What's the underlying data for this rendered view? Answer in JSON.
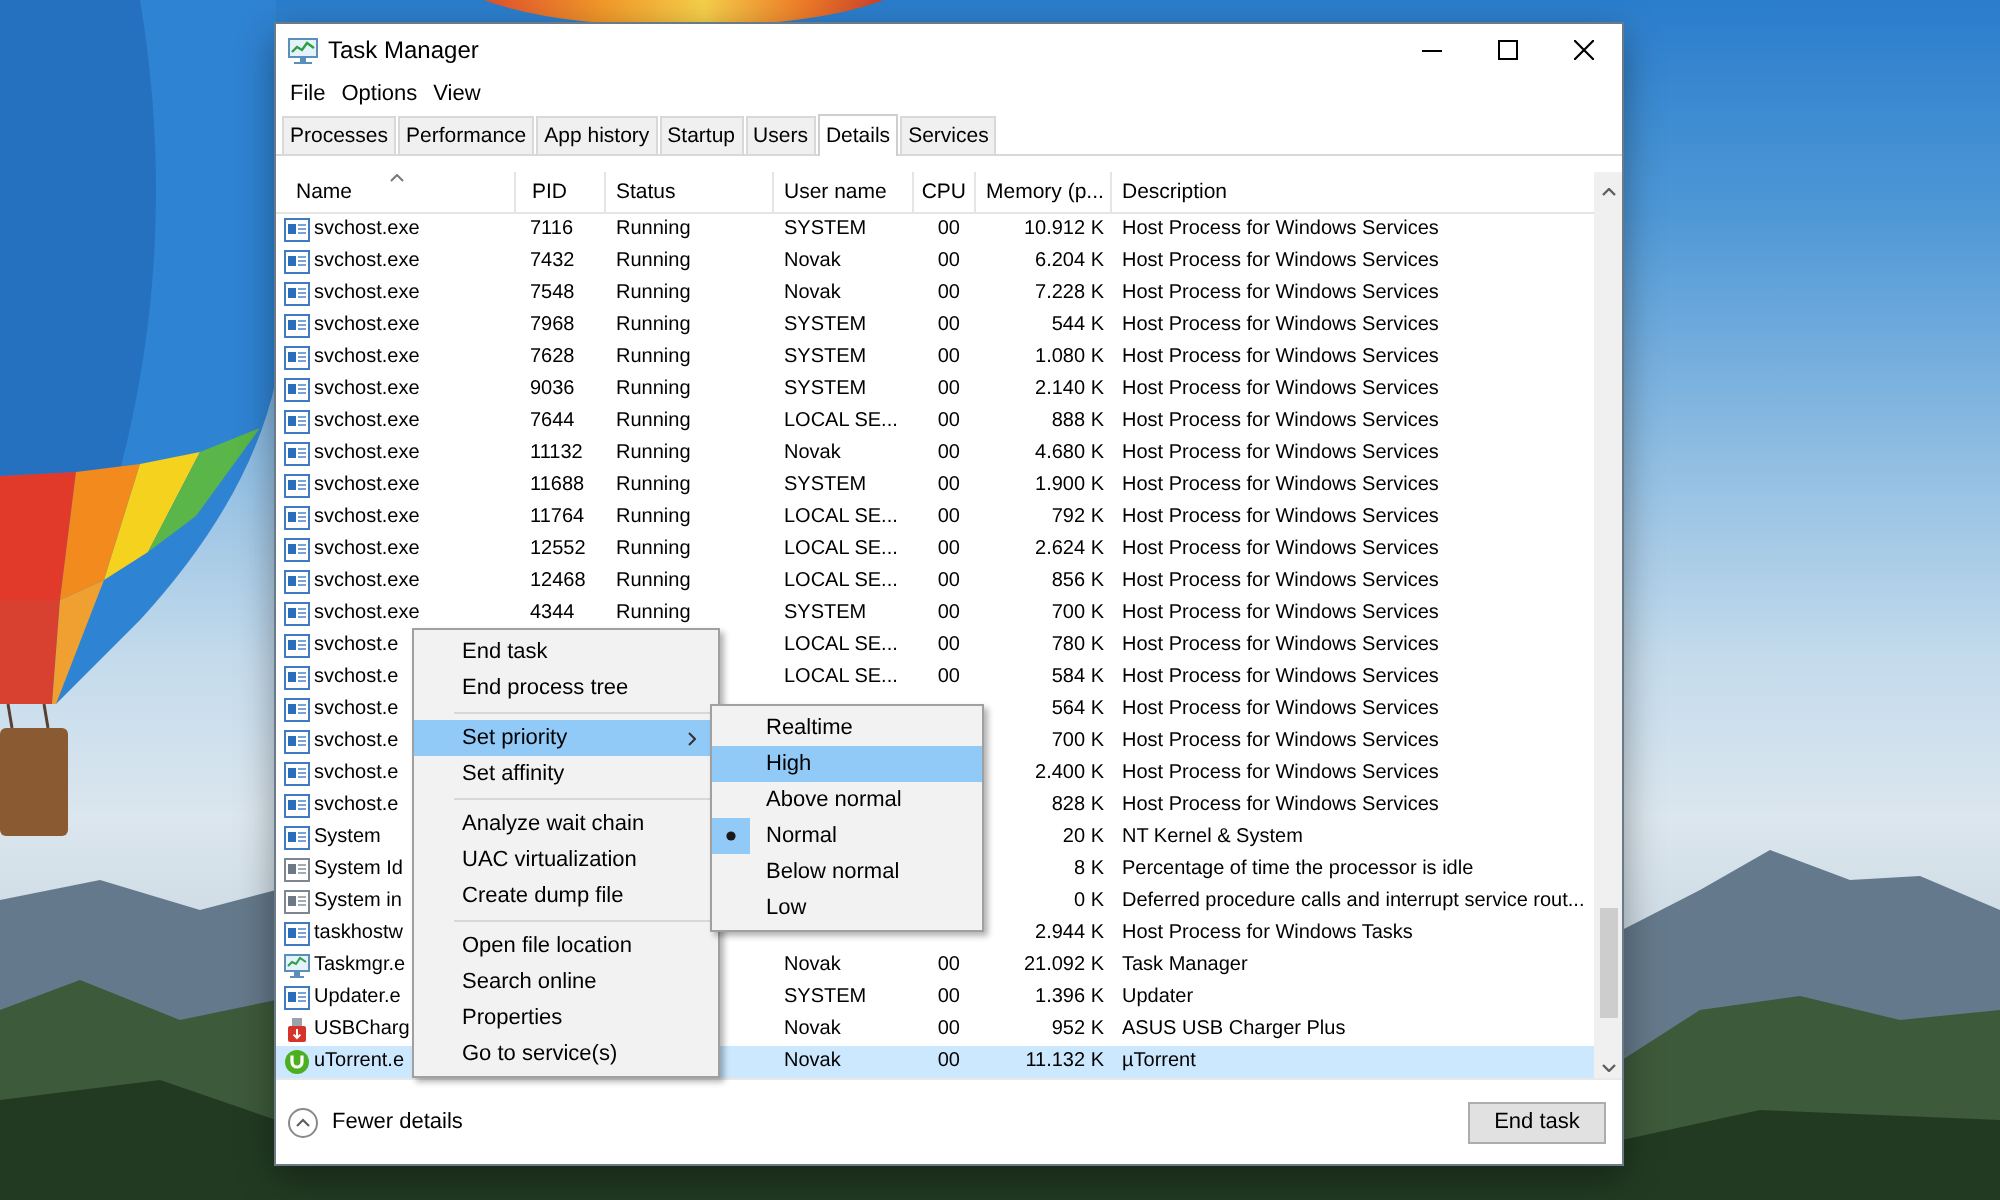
{
  "window": {
    "title": "Task Manager"
  },
  "menu_bar": [
    "File",
    "Options",
    "View"
  ],
  "tabs": [
    {
      "label": "Processes",
      "selected": false
    },
    {
      "label": "Performance",
      "selected": false
    },
    {
      "label": "App history",
      "selected": false
    },
    {
      "label": "Startup",
      "selected": false
    },
    {
      "label": "Users",
      "selected": false
    },
    {
      "label": "Details",
      "selected": true
    },
    {
      "label": "Services",
      "selected": false
    }
  ],
  "table": {
    "columns": [
      {
        "label": "Name",
        "sorted": true
      },
      {
        "label": "PID",
        "sorted": false
      },
      {
        "label": "Status",
        "sorted": false
      },
      {
        "label": "User name",
        "sorted": false
      },
      {
        "label": "CPU",
        "sorted": false
      },
      {
        "label": "Memory (p...",
        "sorted": false
      },
      {
        "label": "Description",
        "sorted": false
      }
    ],
    "rows": [
      {
        "kind": "exe",
        "selected": false,
        "name": "svchost.exe",
        "pid": "7116",
        "status": "Running",
        "user": "SYSTEM",
        "cpu": "00",
        "memory": "10.912 K",
        "description": "Host Process for Windows Services"
      },
      {
        "kind": "exe",
        "selected": false,
        "name": "svchost.exe",
        "pid": "7432",
        "status": "Running",
        "user": "Novak",
        "cpu": "00",
        "memory": "6.204 K",
        "description": "Host Process for Windows Services"
      },
      {
        "kind": "exe",
        "selected": false,
        "name": "svchost.exe",
        "pid": "7548",
        "status": "Running",
        "user": "Novak",
        "cpu": "00",
        "memory": "7.228 K",
        "description": "Host Process for Windows Services"
      },
      {
        "kind": "exe",
        "selected": false,
        "name": "svchost.exe",
        "pid": "7968",
        "status": "Running",
        "user": "SYSTEM",
        "cpu": "00",
        "memory": "544 K",
        "description": "Host Process for Windows Services"
      },
      {
        "kind": "exe",
        "selected": false,
        "name": "svchost.exe",
        "pid": "7628",
        "status": "Running",
        "user": "SYSTEM",
        "cpu": "00",
        "memory": "1.080 K",
        "description": "Host Process for Windows Services"
      },
      {
        "kind": "exe",
        "selected": false,
        "name": "svchost.exe",
        "pid": "9036",
        "status": "Running",
        "user": "SYSTEM",
        "cpu": "00",
        "memory": "2.140 K",
        "description": "Host Process for Windows Services"
      },
      {
        "kind": "exe",
        "selected": false,
        "name": "svchost.exe",
        "pid": "7644",
        "status": "Running",
        "user": "LOCAL SE...",
        "cpu": "00",
        "memory": "888 K",
        "description": "Host Process for Windows Services"
      },
      {
        "kind": "exe",
        "selected": false,
        "name": "svchost.exe",
        "pid": "11132",
        "status": "Running",
        "user": "Novak",
        "cpu": "00",
        "memory": "4.680 K",
        "description": "Host Process for Windows Services"
      },
      {
        "kind": "exe",
        "selected": false,
        "name": "svchost.exe",
        "pid": "11688",
        "status": "Running",
        "user": "SYSTEM",
        "cpu": "00",
        "memory": "1.900 K",
        "description": "Host Process for Windows Services"
      },
      {
        "kind": "exe",
        "selected": false,
        "name": "svchost.exe",
        "pid": "11764",
        "status": "Running",
        "user": "LOCAL SE...",
        "cpu": "00",
        "memory": "792 K",
        "description": "Host Process for Windows Services"
      },
      {
        "kind": "exe",
        "selected": false,
        "name": "svchost.exe",
        "pid": "12552",
        "status": "Running",
        "user": "LOCAL SE...",
        "cpu": "00",
        "memory": "2.624 K",
        "description": "Host Process for Windows Services"
      },
      {
        "kind": "exe",
        "selected": false,
        "name": "svchost.exe",
        "pid": "12468",
        "status": "Running",
        "user": "LOCAL SE...",
        "cpu": "00",
        "memory": "856 K",
        "description": "Host Process for Windows Services"
      },
      {
        "kind": "exe",
        "selected": false,
        "name": "svchost.exe",
        "pid": "4344",
        "status": "Running",
        "user": "SYSTEM",
        "cpu": "00",
        "memory": "700 K",
        "description": "Host Process for Windows Services"
      },
      {
        "kind": "exe",
        "selected": false,
        "name": "svchost.e",
        "user": "LOCAL SE...",
        "cpu": "00",
        "memory": "780 K",
        "description": "Host Process for Windows Services"
      },
      {
        "kind": "exe",
        "selected": false,
        "name": "svchost.e",
        "user": "LOCAL SE...",
        "cpu": "00",
        "memory": "584 K",
        "description": "Host Process for Windows Services"
      },
      {
        "kind": "exe",
        "selected": false,
        "name": "svchost.e",
        "memory": "564 K",
        "description": "Host Process for Windows Services"
      },
      {
        "kind": "exe",
        "selected": false,
        "name": "svchost.e",
        "memory": "700 K",
        "description": "Host Process for Windows Services"
      },
      {
        "kind": "exe",
        "selected": false,
        "name": "svchost.e",
        "memory": "2.400 K",
        "description": "Host Process for Windows Services"
      },
      {
        "kind": "exe",
        "selected": false,
        "name": "svchost.e",
        "memory": "828 K",
        "description": "Host Process for Windows Services"
      },
      {
        "kind": "exe",
        "selected": false,
        "name": "System",
        "memory": "20 K",
        "description": "NT Kernel & System"
      },
      {
        "kind": "virtual",
        "selected": false,
        "name": "System Id",
        "memory": "8 K",
        "description": "Percentage of time the processor is idle"
      },
      {
        "kind": "virtual",
        "selected": false,
        "name": "System in",
        "memory": "0 K",
        "description": "Deferred procedure calls and interrupt service rout..."
      },
      {
        "kind": "exe",
        "selected": false,
        "name": "taskhostw",
        "memory": "2.944 K",
        "description": "Host Process for Windows Tasks"
      },
      {
        "kind": "taskmgr",
        "selected": false,
        "name": "Taskmgr.e",
        "user": "Novak",
        "cpu": "00",
        "memory": "21.092 K",
        "description": "Task Manager"
      },
      {
        "kind": "exe",
        "selected": false,
        "name": "Updater.e",
        "user": "SYSTEM",
        "cpu": "00",
        "memory": "1.396 K",
        "description": "Updater"
      },
      {
        "kind": "usb",
        "selected": false,
        "name": "USBCharg",
        "user": "Novak",
        "cpu": "00",
        "memory": "952 K",
        "description": "ASUS USB Charger Plus"
      },
      {
        "kind": "torrent",
        "selected": true,
        "name": "uTorrent.e",
        "user": "Novak",
        "cpu": "00",
        "memory": "11.132 K",
        "description": "µTorrent"
      }
    ]
  },
  "context_menu": {
    "groups": [
      {
        "items": [
          {
            "label": "End task",
            "highlighted": false,
            "submenu": false
          },
          {
            "label": "End process tree",
            "highlighted": false,
            "submenu": false
          }
        ]
      },
      {
        "items": [
          {
            "label": "Set priority",
            "highlighted": true,
            "submenu": true
          },
          {
            "label": "Set affinity",
            "highlighted": false,
            "submenu": false
          }
        ]
      },
      {
        "items": [
          {
            "label": "Analyze wait chain",
            "highlighted": false,
            "submenu": false
          },
          {
            "label": "UAC virtualization",
            "highlighted": false,
            "submenu": false
          },
          {
            "label": "Create dump file",
            "highlighted": false,
            "submenu": false
          }
        ]
      },
      {
        "items": [
          {
            "label": "Open file location",
            "highlighted": false,
            "submenu": false
          },
          {
            "label": "Search online",
            "highlighted": false,
            "submenu": false
          },
          {
            "label": "Properties",
            "highlighted": false,
            "submenu": false
          },
          {
            "label": "Go to service(s)",
            "highlighted": false,
            "submenu": false
          }
        ]
      }
    ]
  },
  "priority_submenu": {
    "items": [
      {
        "label": "Realtime",
        "highlighted": false,
        "checked": false
      },
      {
        "label": "High",
        "highlighted": true,
        "checked": false
      },
      {
        "label": "Above normal",
        "highlighted": false,
        "checked": false
      },
      {
        "label": "Normal",
        "highlighted": false,
        "checked": true
      },
      {
        "label": "Below normal",
        "highlighted": false,
        "checked": false
      },
      {
        "label": "Low",
        "highlighted": false,
        "checked": false
      }
    ]
  },
  "footer": {
    "toggle": "Fewer details",
    "button": "End task"
  }
}
